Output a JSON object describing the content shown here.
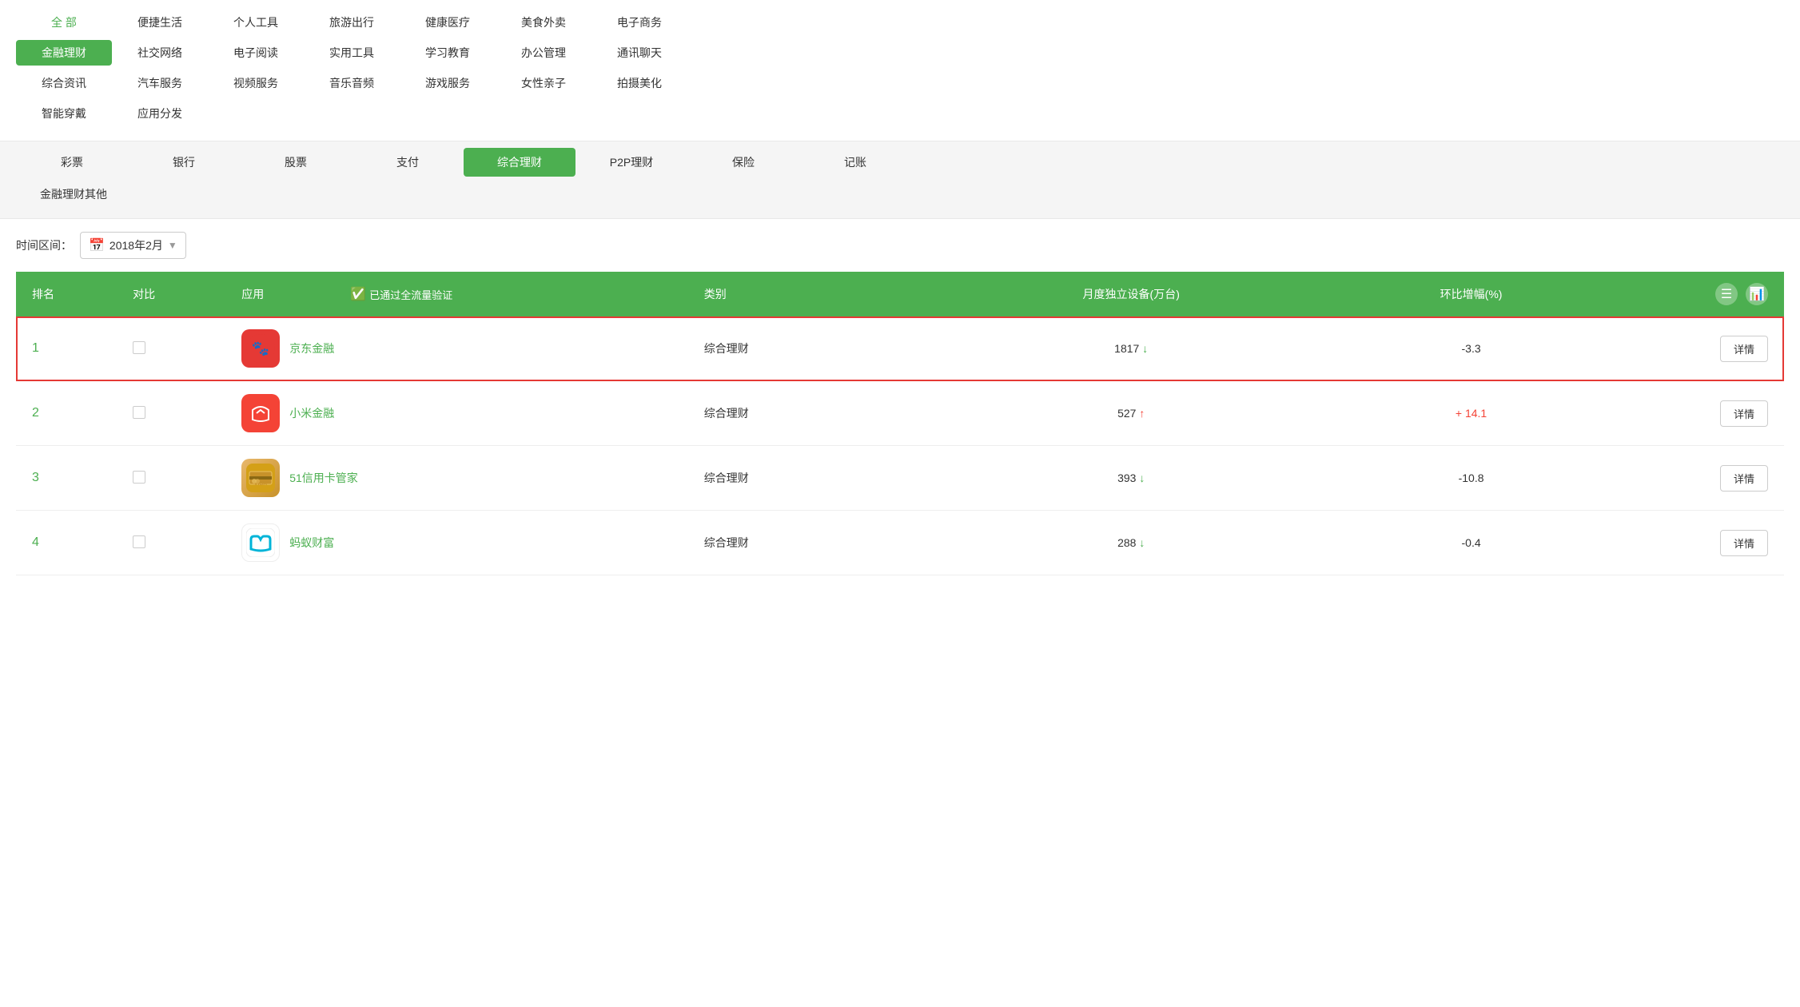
{
  "categories": {
    "main": [
      {
        "id": "all",
        "label": "全 部",
        "active": false,
        "green": true
      },
      {
        "id": "convenient",
        "label": "便捷生活",
        "active": false
      },
      {
        "id": "personal-tools",
        "label": "个人工具",
        "active": false
      },
      {
        "id": "travel",
        "label": "旅游出行",
        "active": false
      },
      {
        "id": "health",
        "label": "健康医疗",
        "active": false
      },
      {
        "id": "food",
        "label": "美食外卖",
        "active": false
      },
      {
        "id": "ecommerce",
        "label": "电子商务",
        "active": false
      },
      {
        "id": "finance",
        "label": "金融理财",
        "active": true
      },
      {
        "id": "social",
        "label": "社交网络",
        "active": false
      },
      {
        "id": "ereading",
        "label": "电子阅读",
        "active": false
      },
      {
        "id": "tools",
        "label": "实用工具",
        "active": false
      },
      {
        "id": "education",
        "label": "学习教育",
        "active": false
      },
      {
        "id": "office",
        "label": "办公管理",
        "active": false
      },
      {
        "id": "chat",
        "label": "通讯聊天",
        "active": false
      },
      {
        "id": "news",
        "label": "综合资讯",
        "active": false
      },
      {
        "id": "auto",
        "label": "汽车服务",
        "active": false
      },
      {
        "id": "video",
        "label": "视频服务",
        "active": false
      },
      {
        "id": "music",
        "label": "音乐音频",
        "active": false
      },
      {
        "id": "game",
        "label": "游戏服务",
        "active": false
      },
      {
        "id": "female",
        "label": "女性亲子",
        "active": false
      },
      {
        "id": "photo",
        "label": "拍摄美化",
        "active": false
      },
      {
        "id": "wearable",
        "label": "智能穿戴",
        "active": false
      },
      {
        "id": "appstore",
        "label": "应用分发",
        "active": false
      }
    ],
    "sub": [
      {
        "id": "lottery",
        "label": "彩票",
        "active": false
      },
      {
        "id": "bank",
        "label": "银行",
        "active": false
      },
      {
        "id": "stock",
        "label": "股票",
        "active": false
      },
      {
        "id": "payment",
        "label": "支付",
        "active": false
      },
      {
        "id": "comprehensive",
        "label": "综合理财",
        "active": true
      },
      {
        "id": "p2p",
        "label": "P2P理财",
        "active": false
      },
      {
        "id": "insurance",
        "label": "保险",
        "active": false
      },
      {
        "id": "accounting",
        "label": "记账",
        "active": false
      },
      {
        "id": "other",
        "label": "金融理财其他",
        "active": false
      }
    ]
  },
  "time_filter": {
    "label": "时间区间：",
    "value": "2018年2月"
  },
  "table": {
    "headers": {
      "rank": "排名",
      "compare": "对比",
      "app": "应用",
      "verified": "已通过全流量验证",
      "category": "类别",
      "devices": "月度独立设备(万台)",
      "change": "环比增幅(%)"
    },
    "rows": [
      {
        "rank": 1,
        "app_name": "京东金融",
        "category": "综合理财",
        "devices": 1817,
        "change": -3.3,
        "change_str": "-3.3",
        "trend": "down",
        "highlighted": true
      },
      {
        "rank": 2,
        "app_name": "小米金融",
        "category": "综合理财",
        "devices": 527,
        "change": 14.1,
        "change_str": "+ 14.1",
        "trend": "up",
        "highlighted": false
      },
      {
        "rank": 3,
        "app_name": "51信用卡管家",
        "category": "综合理财",
        "devices": 393,
        "change": -10.8,
        "change_str": "-10.8",
        "trend": "down",
        "highlighted": false
      },
      {
        "rank": 4,
        "app_name": "蚂蚁财富",
        "category": "综合理财",
        "devices": 288,
        "change": -0.4,
        "change_str": "-0.4",
        "trend": "down",
        "highlighted": false
      }
    ],
    "detail_label": "详情"
  },
  "colors": {
    "green": "#4caf50",
    "red": "#e53935",
    "orange": "#ff9800"
  }
}
